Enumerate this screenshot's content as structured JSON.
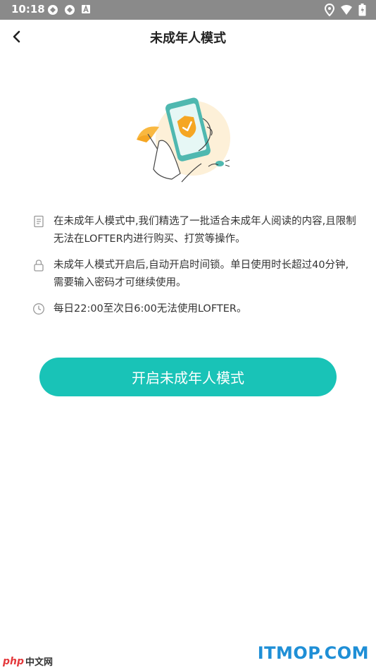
{
  "status_bar": {
    "time": "10:18"
  },
  "nav": {
    "title": "未成年人模式"
  },
  "info_items": [
    {
      "icon": "document-icon",
      "text": "在未成年人模式中,我们精选了一批适合未成年人阅读的内容,且限制无法在LOFTER内进行购买、打赏等操作。"
    },
    {
      "icon": "lock-icon",
      "text": "未成年人模式开启后,自动开启时间锁。单日使用时长超过40分钟,需要输入密码才可继续使用。"
    },
    {
      "icon": "clock-icon",
      "text": "每日22:00至次日6:00无法使用LOFTER。"
    }
  ],
  "cta": {
    "label": "开启未成年人模式"
  },
  "watermarks": {
    "left_php": "php",
    "left_cn": "中文网",
    "right": "ITMOP.COM"
  },
  "colors": {
    "accent": "#19c3b7",
    "illustration_bg": "#fdf0d8",
    "shield": "#f5a623"
  }
}
